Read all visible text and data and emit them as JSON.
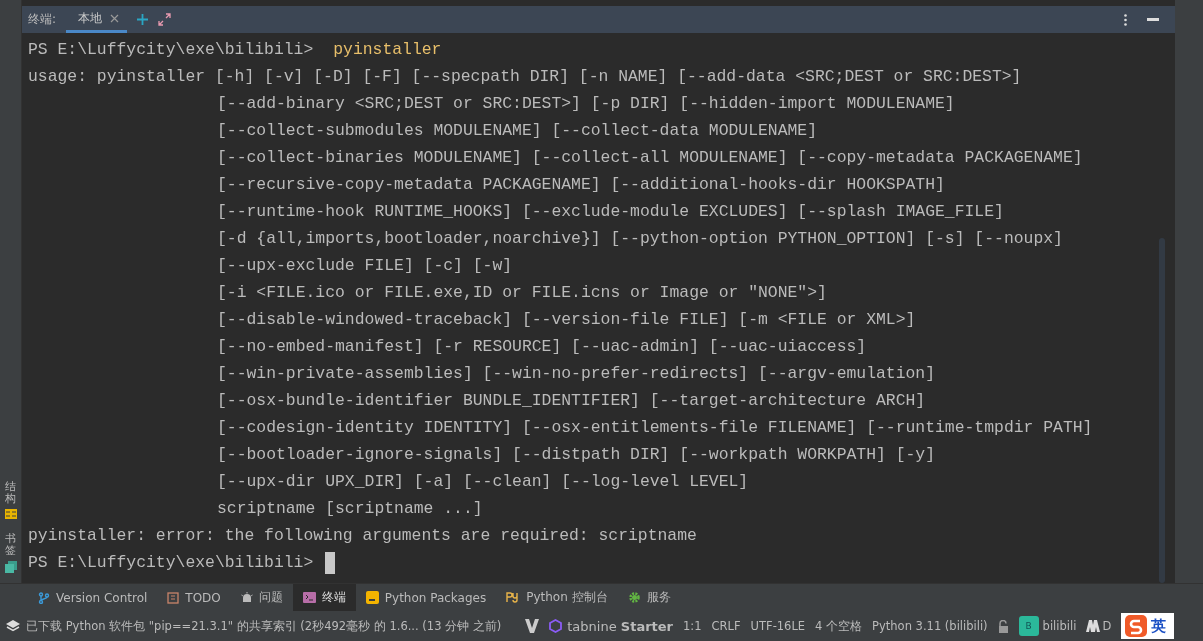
{
  "terminal": {
    "title": "终端:",
    "tabs": [
      {
        "label": "本地",
        "selected": true
      }
    ],
    "lines": [
      {
        "kind": "prompt",
        "text": "PS E:\\Luffycity\\exe\\bilibili>",
        "command": "pyinstaller"
      },
      {
        "kind": "output",
        "text": "usage: pyinstaller [-h] [-v] [-D] [-F] [--specpath DIR] [-n NAME] [--add-data <SRC;DEST or SRC:DEST>]"
      },
      {
        "kind": "continuation",
        "text": "[--add-binary <SRC;DEST or SRC:DEST>] [-p DIR] [--hidden-import MODULENAME]"
      },
      {
        "kind": "continuation",
        "text": "[--collect-submodules MODULENAME] [--collect-data MODULENAME]"
      },
      {
        "kind": "continuation",
        "text": "[--collect-binaries MODULENAME] [--collect-all MODULENAME] [--copy-metadata PACKAGENAME]"
      },
      {
        "kind": "continuation",
        "text": "[--recursive-copy-metadata PACKAGENAME] [--additional-hooks-dir HOOKSPATH]"
      },
      {
        "kind": "continuation",
        "text": "[--runtime-hook RUNTIME_HOOKS] [--exclude-module EXCLUDES] [--splash IMAGE_FILE]"
      },
      {
        "kind": "continuation",
        "text": "[-d {all,imports,bootloader,noarchive}] [--python-option PYTHON_OPTION] [-s] [--noupx]"
      },
      {
        "kind": "continuation",
        "text": "[--upx-exclude FILE] [-c] [-w]"
      },
      {
        "kind": "continuation",
        "text": "[-i <FILE.ico or FILE.exe,ID or FILE.icns or Image or \"NONE\">]"
      },
      {
        "kind": "continuation",
        "text": "[--disable-windowed-traceback] [--version-file FILE] [-m <FILE or XML>]"
      },
      {
        "kind": "continuation",
        "text": "[--no-embed-manifest] [-r RESOURCE] [--uac-admin] [--uac-uiaccess]"
      },
      {
        "kind": "continuation",
        "text": "[--win-private-assemblies] [--win-no-prefer-redirects] [--argv-emulation]"
      },
      {
        "kind": "continuation",
        "text": "[--osx-bundle-identifier BUNDLE_IDENTIFIER] [--target-architecture ARCH]"
      },
      {
        "kind": "continuation",
        "text": "[--codesign-identity IDENTITY] [--osx-entitlements-file FILENAME] [--runtime-tmpdir PATH]"
      },
      {
        "kind": "continuation",
        "text": "[--bootloader-ignore-signals] [--distpath DIR] [--workpath WORKPATH] [-y]"
      },
      {
        "kind": "continuation",
        "text": "[--upx-dir UPX_DIR] [-a] [--clean] [--log-level LEVEL]"
      },
      {
        "kind": "continuation",
        "text": "scriptname [scriptname ...]"
      },
      {
        "kind": "output",
        "text": "pyinstaller: error: the following arguments are required: scriptname"
      },
      {
        "kind": "prompt",
        "text": "PS E:\\Luffycity\\exe\\bilibili>",
        "cursor": true
      }
    ]
  },
  "side_tabs": [
    {
      "label": "结构"
    },
    {
      "label": "书签"
    }
  ],
  "tool_tabs": [
    {
      "label": "Version Control",
      "selected": false
    },
    {
      "label": "TODO",
      "selected": false
    },
    {
      "label": "问题",
      "selected": false
    },
    {
      "label": "终端",
      "selected": true
    },
    {
      "label": "Python Packages",
      "selected": false
    },
    {
      "label": "Python 控制台",
      "selected": false
    },
    {
      "label": "服务",
      "selected": false
    }
  ],
  "status": {
    "message": "已下载 Python 软件包 \"pip==21.3.1\" 的共享索引 (2秒492毫秒 的 1.6... (13 分钟 之前)",
    "tabnine": "tabnine",
    "tabnine_plan": "Starter",
    "items": [
      "1:1",
      "CRLF",
      "UTF-16LE",
      "4 个空格",
      "Python 3.11 (bilibili)"
    ],
    "project_badge": "B",
    "project": "bilibili",
    "extra": "D",
    "ime": "英"
  }
}
